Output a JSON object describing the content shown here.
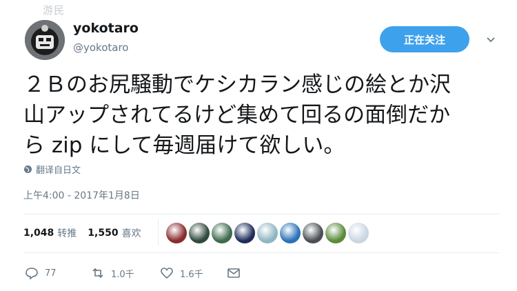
{
  "watermark": "游民",
  "user": {
    "name": "yokotaro",
    "handle": "@yokotaro"
  },
  "follow_button": {
    "label": "正在关注",
    "color": "#3ea1ec"
  },
  "tweet": {
    "lines": [
      "２Ｂのお尻騒動でケシカラン感じの絵とか沢",
      "山アップされてるけど集めて回るの面倒だか",
      "ら zip にして毎週届けて欲しい。"
    ],
    "translate_label": "翻译自日文",
    "timestamp": "上午4:00 - 2017年1月8日"
  },
  "stats": {
    "retweets_count": "1,048",
    "retweets_label": "转推",
    "likes_count": "1,550",
    "likes_label": "喜欢"
  },
  "liker_avatars": [
    {
      "icon": "avatar-1",
      "color": "#8a2b2b"
    },
    {
      "icon": "avatar-2",
      "color": "#2f4a3c"
    },
    {
      "icon": "avatar-3",
      "color": "#3f6a4e"
    },
    {
      "icon": "avatar-4",
      "color": "#1f2c5a"
    },
    {
      "icon": "avatar-5",
      "color": "#8fb6c2"
    },
    {
      "icon": "avatar-6",
      "color": "#2b72b8"
    },
    {
      "icon": "avatar-7",
      "color": "#4a4f55"
    },
    {
      "icon": "avatar-8",
      "color": "#5a8b3a"
    },
    {
      "icon": "avatar-9",
      "color": "#c9d6e2"
    }
  ],
  "actions": {
    "reply_count": "77",
    "retweet_count": "1.0千",
    "like_count": "1.6千"
  }
}
